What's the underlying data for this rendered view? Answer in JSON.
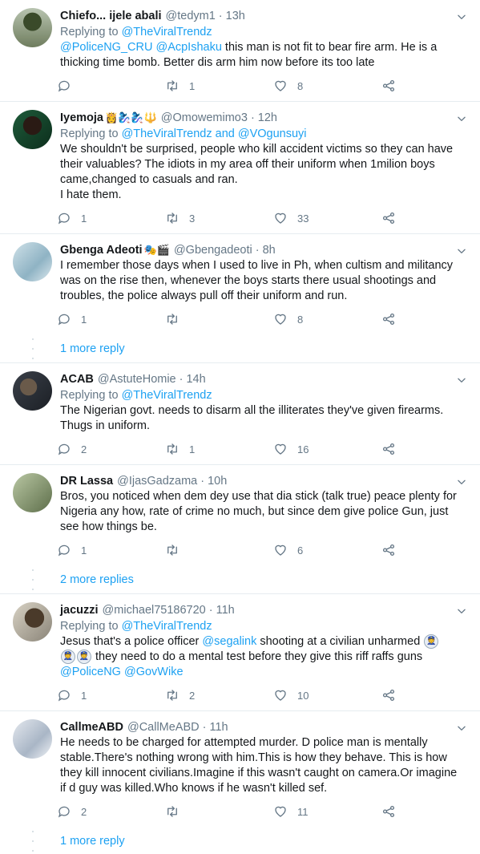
{
  "tweets": [
    {
      "name": "Chiefo... ijele abali",
      "emoji": "",
      "handle": "@tedym1",
      "time": "13h",
      "replying_label": "Replying to",
      "replying_to": "@TheViralTrendz",
      "mentions": "@PoliceNG_CRU @AcpIshaku",
      "text": " this man is not fit to bear fire arm. He is a thicking time bomb. Better dis arm him now before its too late",
      "replies": "",
      "retweets": "1",
      "likes": "8"
    },
    {
      "name": "Iyemoja",
      "emoji": "👸🧞‍♀️🧞‍♀️🔱",
      "handle": "@Omowemimo3",
      "time": "12h",
      "replying_label": "Replying to",
      "replying_to": "@TheViralTrendz and @VOgunsuyi",
      "text_lines": [
        "We shouldn't be surprised, people who kill accident victims so they can have their valuables? The idiots in my area off their uniform when 1milion boys came,changed to casuals and ran.",
        "I hate them."
      ],
      "replies": "1",
      "retweets": "3",
      "likes": "33"
    },
    {
      "name": "Gbenga Adeoti",
      "emoji": "🎭🎬",
      "handle": "@Gbengadeoti",
      "time": "8h",
      "text": "I remember those days when I used to live in Ph, when cultism and militancy was on the rise then, whenever the boys starts there usual shootings and troubles, the police always pull off their uniform and run.",
      "replies": "1",
      "retweets": "",
      "likes": "8",
      "more_replies": "1 more reply"
    },
    {
      "name": "ACAB",
      "handle": "@AstuteHomie",
      "time": "14h",
      "replying_label": "Replying to",
      "replying_to": "@TheViralTrendz",
      "text": "The Nigerian govt. needs to disarm all the illiterates they've given firearms. Thugs in uniform.",
      "replies": "2",
      "retweets": "1",
      "likes": "16"
    },
    {
      "name": "DR Lassa",
      "handle": "@IjasGadzama",
      "time": "10h",
      "text": "Bros, you noticed when dem dey use that dia stick (talk true) peace plenty for Nigeria any how, rate of crime no much, but since dem give police Gun, just see how things be.",
      "replies": "1",
      "retweets": "",
      "likes": "6",
      "more_replies": "2 more replies"
    },
    {
      "name": "jacuzzi",
      "handle": "@michael75186720",
      "time": "11h",
      "replying_label": "Replying to",
      "replying_to": "@TheViralTrendz",
      "text_a": "Jesus that's a police officer ",
      "mention_a": "@segalink",
      "text_b": " shooting at a civilian unharmed ",
      "text_c": " they need to do a mental test before they give this riff raffs guns",
      "mentions_end": "@PoliceNG @GovWike",
      "replies": "1",
      "retweets": "2",
      "likes": "10"
    },
    {
      "name": "CallmeABD",
      "handle": "@CallMeABD",
      "time": "11h",
      "text": "He needs to be charged for attempted murder. D police man is mentally stable.There's nothing wrong with him.This is how they behave. This is how they kill innocent civilians.Imagine if this wasn't caught on camera.Or imagine if d guy was killed.Who knows if he wasn't killed sef.",
      "replies": "2",
      "retweets": "",
      "likes": "11",
      "more_replies": "1 more reply"
    }
  ],
  "colors": {
    "accent": "#1da1f2",
    "muted": "#657786",
    "border": "#e6ecf0"
  },
  "icons": [
    "reply-icon",
    "retweet-icon",
    "like-icon",
    "share-icon",
    "chevron-down-icon"
  ]
}
